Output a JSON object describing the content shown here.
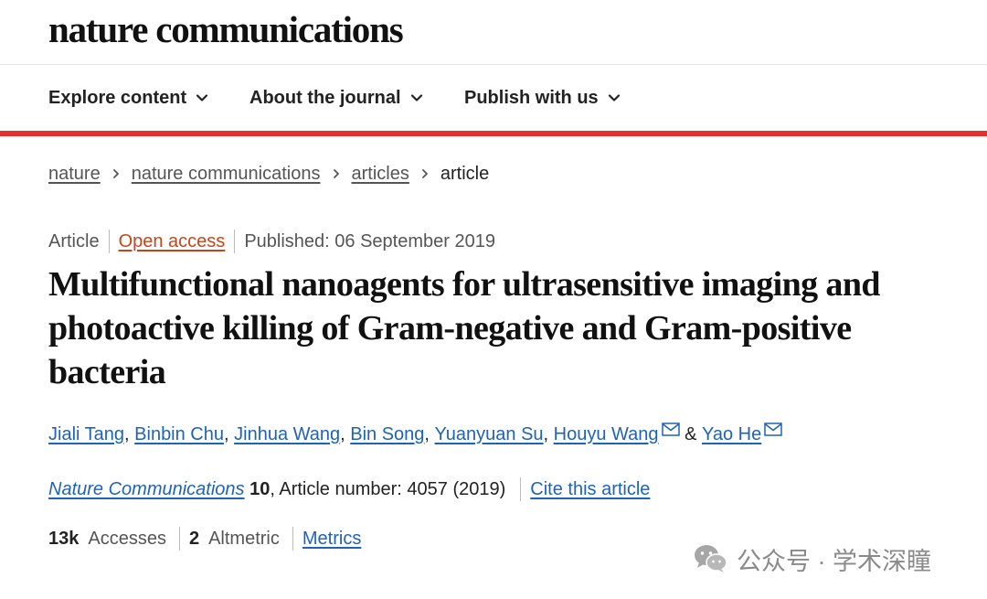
{
  "header": {
    "logo": "nature communications",
    "nav": [
      {
        "label": "Explore content"
      },
      {
        "label": "About the journal"
      },
      {
        "label": "Publish with us"
      }
    ],
    "accent_color": "#e6302c"
  },
  "breadcrumb": {
    "items": [
      "nature",
      "nature communications",
      "articles"
    ],
    "current": "article"
  },
  "meta": {
    "type": "Article",
    "access": "Open access",
    "published": "Published: 06 September 2019"
  },
  "article": {
    "title": "Multifunctional nanoagents for ultrasensitive imaging and photoactive killing of Gram-negative and Gram-positive bacteria"
  },
  "authors": {
    "list": [
      "Jiali Tang",
      "Binbin Chu",
      "Jinhua Wang",
      "Bin Song",
      "Yuanyuan Su",
      "Houyu Wang",
      "Yao He"
    ],
    "comma": ",",
    "ampersand": "&",
    "link_color": "#1f63b4"
  },
  "citation": {
    "journal": "Nature Communications",
    "volume": "10",
    "article_number": ", Article number: 4057 (2019)",
    "cite_link": "Cite this article"
  },
  "metrics": {
    "accesses_value": "13k",
    "accesses_label": "Accesses",
    "altmetric_value": "2",
    "altmetric_label": "Altmetric",
    "metrics_link": "Metrics"
  },
  "watermark": {
    "text": "公众号 · 学术深瞳",
    "icon": "wechat-icon"
  }
}
